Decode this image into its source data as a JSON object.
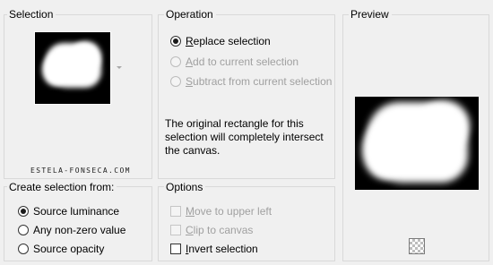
{
  "selection": {
    "title": "Selection",
    "watermark": "ESTELA-FONSECA.COM"
  },
  "operation": {
    "title": "Operation",
    "options": [
      {
        "label": "Replace selection",
        "checked": true,
        "enabled": true
      },
      {
        "label": "Add to current selection",
        "checked": false,
        "enabled": false
      },
      {
        "label": "Subtract from current selection",
        "checked": false,
        "enabled": false
      }
    ],
    "description": "The original rectangle for this selection will completely intersect the canvas."
  },
  "preview": {
    "title": "Preview",
    "toggle_icon": "checkerboard-icon"
  },
  "create_from": {
    "title": "Create selection from:",
    "options": [
      {
        "label": "Source luminance",
        "checked": true
      },
      {
        "label": "Any non-zero value",
        "checked": false
      },
      {
        "label": "Source opacity",
        "checked": false
      }
    ]
  },
  "options": {
    "title": "Options",
    "items": [
      {
        "label": "Move to upper left",
        "checked": false,
        "enabled": false
      },
      {
        "label": "Clip to canvas",
        "checked": false,
        "enabled": false
      },
      {
        "label": "Invert selection",
        "checked": false,
        "enabled": true
      }
    ]
  }
}
